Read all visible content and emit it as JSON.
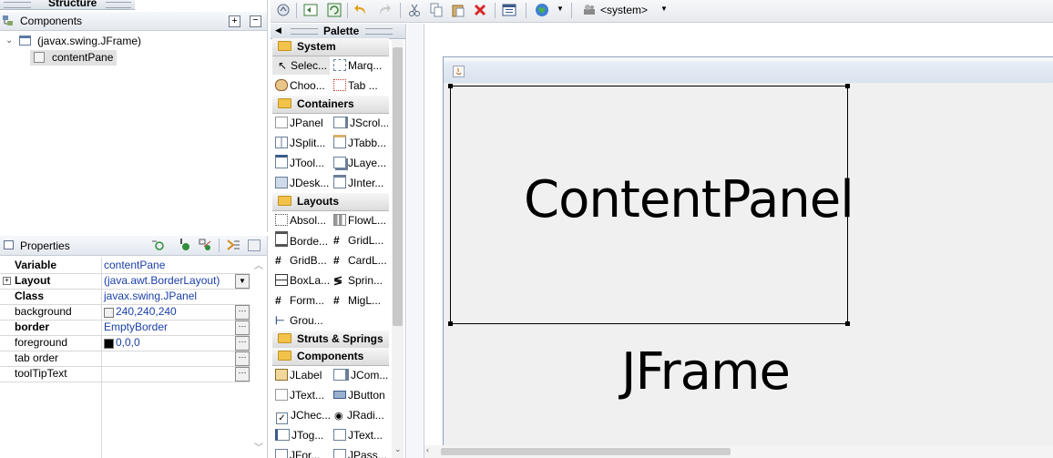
{
  "structure": {
    "title": "Structure",
    "components_label": "Components",
    "tree": [
      {
        "label": "(javax.swing.JFrame)"
      },
      {
        "label": "contentPane"
      }
    ]
  },
  "properties": {
    "title": "Properties",
    "rows": [
      {
        "key": "Variable",
        "value": "contentPane",
        "bold": true
      },
      {
        "key": "Layout",
        "value": "(java.awt.BorderLayout)",
        "bold": true
      },
      {
        "key": "Class",
        "value": "javax.swing.JPanel",
        "bold": true
      },
      {
        "key": "background",
        "value": "240,240,240",
        "bold": false
      },
      {
        "key": "border",
        "value": "EmptyBorder",
        "bold": true
      },
      {
        "key": "foreground",
        "value": "0,0,0",
        "bold": false
      },
      {
        "key": "tab order",
        "value": "",
        "bold": false
      },
      {
        "key": "toolTipText",
        "value": "",
        "bold": false
      }
    ]
  },
  "toolbar": {
    "system_label": "<system>"
  },
  "palette": {
    "title": "Palette",
    "categories": {
      "system": "System",
      "containers": "Containers",
      "layouts": "Layouts",
      "struts": "Struts & Springs",
      "components": "Components"
    },
    "system_items": [
      "Selec...",
      "Marq...",
      "Choo...",
      "Tab ..."
    ],
    "container_items": [
      "JPanel",
      "JScrol...",
      "JSplit...",
      "JTabb...",
      "JTool...",
      "JLaye...",
      "JDesk...",
      "JInter..."
    ],
    "layout_items": [
      "Absol...",
      "FlowL...",
      "Borde...",
      "GridL...",
      "GridB...",
      "CardL...",
      "BoxLa...",
      "Sprin...",
      "Form...",
      "MigL...",
      "Grou..."
    ],
    "component_items": [
      "JLabel",
      "JCom...",
      "JText...",
      "JButton",
      "JChec...",
      "JRadi...",
      "JTog...",
      "JText...",
      "JFor...",
      "JPass..."
    ]
  },
  "canvas": {
    "content_panel_label": "ContentPanel",
    "frame_label": "JFrame"
  },
  "colors": {
    "link_blue": "#1a3fa8",
    "selection": "#e1e1e1"
  }
}
